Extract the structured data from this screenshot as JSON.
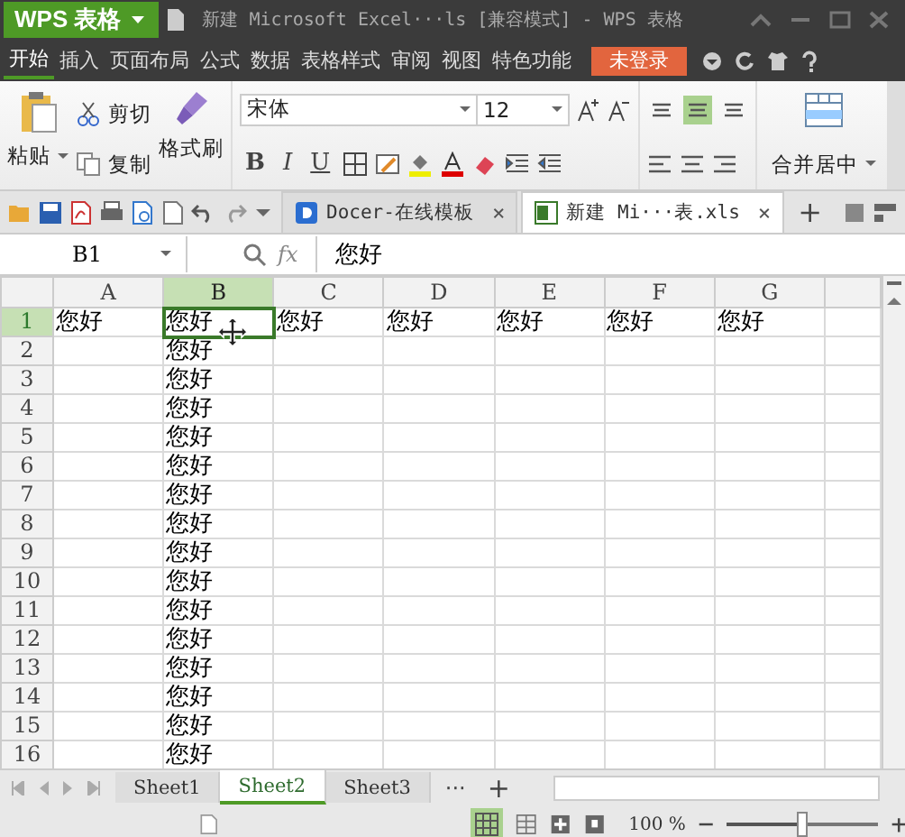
{
  "title_bar": {
    "logo": "WPS 表格",
    "title": "新建 Microsoft Excel···ls [兼容模式] - WPS 表格"
  },
  "menu": {
    "tabs": [
      {
        "label": "开始",
        "selected": true
      },
      {
        "label": "插入",
        "selected": false
      },
      {
        "label": "页面布局",
        "selected": false
      },
      {
        "label": "公式",
        "selected": false
      },
      {
        "label": "数据",
        "selected": false
      },
      {
        "label": "表格样式",
        "selected": false
      },
      {
        "label": "审阅",
        "selected": false
      },
      {
        "label": "视图",
        "selected": false
      },
      {
        "label": "特色功能",
        "selected": false
      }
    ],
    "login": "未登录"
  },
  "ribbon": {
    "paste": "粘贴",
    "cut": "剪切",
    "copy": "复制",
    "format_painter": "格式刷",
    "font": "宋体",
    "font_size": "12",
    "bold": "B",
    "italic": "I",
    "underline": "U",
    "vertical_align": [
      {
        "selected": false
      },
      {
        "selected": true
      },
      {
        "selected": false
      }
    ],
    "merge": "合并居中"
  },
  "doc_tabs": [
    {
      "label": "Docer-在线模板",
      "kind": "docer",
      "selected": false,
      "close": "×"
    },
    {
      "label": "新建 Mi···表.xls",
      "kind": "sheet",
      "selected": true,
      "close": "×"
    }
  ],
  "new_tab": "+",
  "formula_bar": {
    "name_box": "B1",
    "fx": "fx",
    "value": "您好"
  },
  "grid": {
    "columns": [
      {
        "label": "A",
        "selected": false
      },
      {
        "label": "B",
        "selected": true
      },
      {
        "label": "C",
        "selected": false
      },
      {
        "label": "D",
        "selected": false
      },
      {
        "label": "E",
        "selected": false
      },
      {
        "label": "F",
        "selected": false
      },
      {
        "label": "G",
        "selected": false
      }
    ],
    "rows": [
      {
        "label": "1",
        "selected": true,
        "cells": [
          "您好",
          "您好",
          "您好",
          "您好",
          "您好",
          "您好",
          "您好"
        ]
      },
      {
        "label": "2",
        "selected": false,
        "cells": [
          null,
          "您好"
        ]
      },
      {
        "label": "3",
        "selected": false,
        "cells": [
          null,
          "您好"
        ]
      },
      {
        "label": "4",
        "selected": false,
        "cells": [
          null,
          "您好"
        ]
      },
      {
        "label": "5",
        "selected": false,
        "cells": [
          null,
          "您好"
        ]
      },
      {
        "label": "6",
        "selected": false,
        "cells": [
          null,
          "您好"
        ]
      },
      {
        "label": "7",
        "selected": false,
        "cells": [
          null,
          "您好"
        ]
      },
      {
        "label": "8",
        "selected": false,
        "cells": [
          null,
          "您好"
        ]
      },
      {
        "label": "9",
        "selected": false,
        "cells": [
          null,
          "您好"
        ]
      },
      {
        "label": "10",
        "selected": false,
        "cells": [
          null,
          "您好"
        ]
      },
      {
        "label": "11",
        "selected": false,
        "cells": [
          null,
          "您好"
        ]
      },
      {
        "label": "12",
        "selected": false,
        "cells": [
          null,
          "您好"
        ]
      },
      {
        "label": "13",
        "selected": false,
        "cells": [
          null,
          "您好"
        ]
      },
      {
        "label": "14",
        "selected": false,
        "cells": [
          null,
          "您好"
        ]
      },
      {
        "label": "15",
        "selected": false,
        "cells": [
          null,
          "您好"
        ]
      },
      {
        "label": "16",
        "selected": false,
        "cells": [
          null,
          "您好"
        ]
      }
    ]
  },
  "sheet_tabs": {
    "tabs": [
      {
        "label": "Sheet1",
        "selected": false
      },
      {
        "label": "Sheet2",
        "selected": true
      },
      {
        "label": "Sheet3",
        "selected": false
      }
    ],
    "more": "···",
    "add": "+"
  },
  "status_bar": {
    "zoom": "100 %",
    "zoom_slider": {
      "level": 0.5
    }
  }
}
